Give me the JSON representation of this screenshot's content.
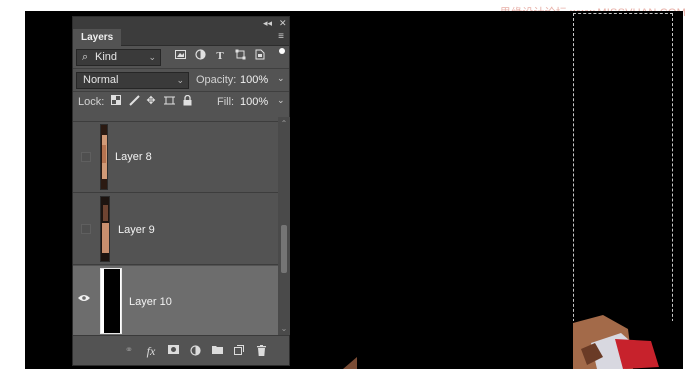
{
  "watermark": "思缘设计论坛 www.MISSVUAN.COM",
  "panel": {
    "tab_label": "Layers",
    "collapse_label": "◂◂",
    "close_label": "✕",
    "menu_label": "≡"
  },
  "filter": {
    "kind_label": "Kind",
    "icons": [
      "pixel-filter-icon",
      "adjustment-filter-icon",
      "type-filter-icon",
      "shape-filter-icon",
      "smart-object-filter-icon"
    ]
  },
  "blend": {
    "mode": "Normal",
    "opacity_label": "Opacity:",
    "opacity_value": "100%"
  },
  "lock": {
    "label": "Lock:",
    "fill_label": "Fill:",
    "fill_value": "100%"
  },
  "layers": [
    {
      "name": "Layer 8",
      "visible": false,
      "selected": false
    },
    {
      "name": "Layer 9",
      "visible": false,
      "selected": false
    },
    {
      "name": "Layer 10",
      "visible": true,
      "selected": true
    }
  ],
  "footer": {
    "icons": [
      "link-layers-icon",
      "fx-icon",
      "mask-icon",
      "adjustment-layer-icon",
      "group-folder-icon",
      "new-layer-icon",
      "trash-icon"
    ],
    "fx_label": "fx"
  },
  "colors": {
    "panel_bg": "#535353",
    "panel_dark": "#3c3c3c",
    "selected_row": "#6d6d6d",
    "canvas": "#000000"
  }
}
